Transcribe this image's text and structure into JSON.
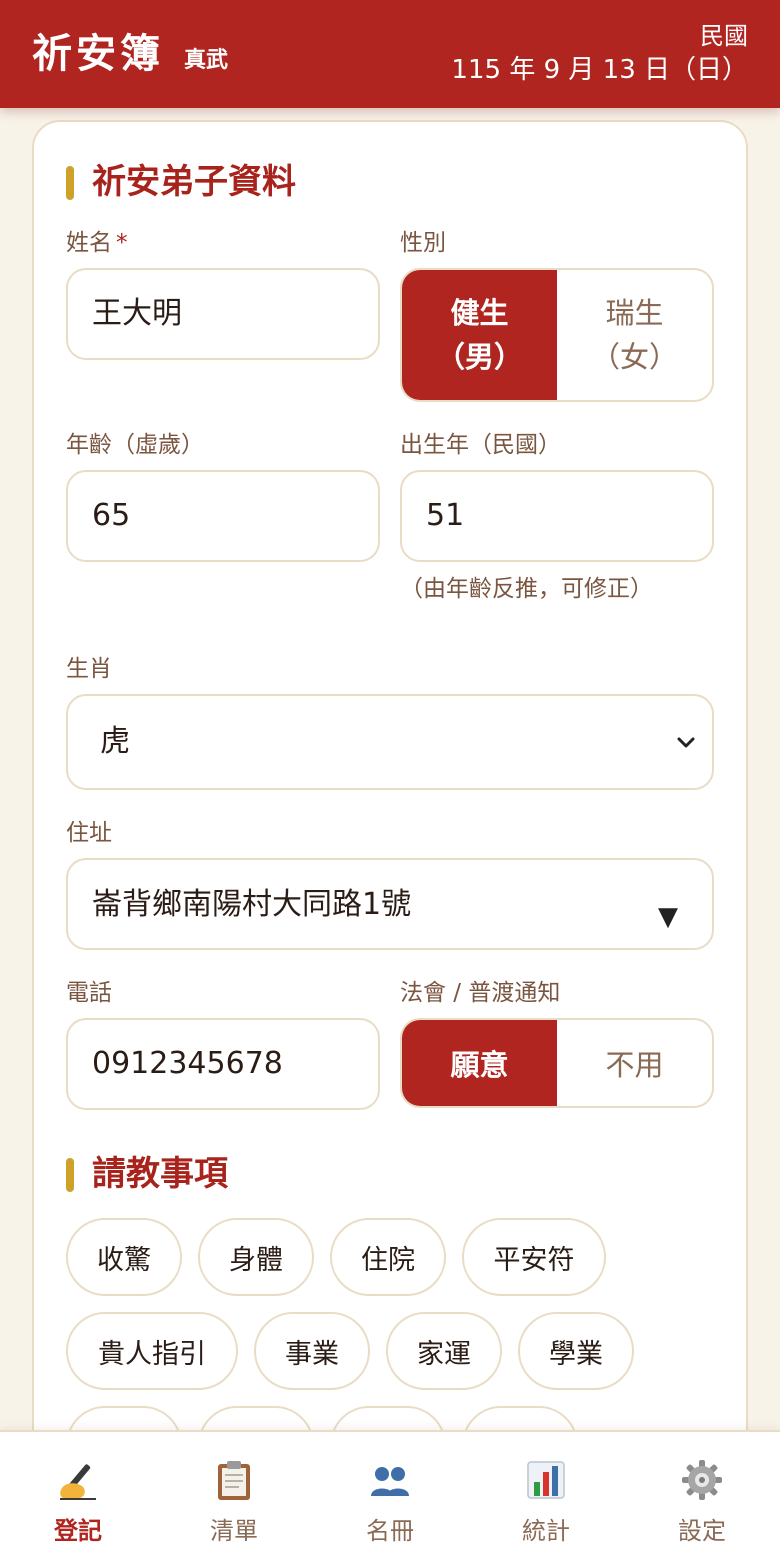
{
  "header": {
    "title": "祈安簿",
    "subtitle": "真武",
    "era": "民國",
    "date": "115 年 9 月 13 日（日）"
  },
  "form": {
    "section_title": "祈安弟子資料",
    "name": {
      "label": "姓名",
      "required_mark": "*",
      "value": "王大明"
    },
    "gender": {
      "label": "性別",
      "options": [
        "健生\n（男）",
        "瑞生\n（女）"
      ],
      "option_lines": [
        [
          "健生",
          "（男）"
        ],
        [
          "瑞生",
          "（女）"
        ]
      ],
      "selected": 0
    },
    "age": {
      "label": "年齡（虛歲）",
      "value": "65"
    },
    "birth_year": {
      "label": "出生年（民國）",
      "value": "51",
      "hint": "（由年齡反推，可修正）"
    },
    "zodiac": {
      "label": "生肖",
      "value": "虎"
    },
    "address": {
      "label": "住址",
      "value": "崙背鄉南陽村大同路1號"
    },
    "phone": {
      "label": "電話",
      "value": "0912345678"
    },
    "notify": {
      "label": "法會 / 普渡通知",
      "options": [
        "願意",
        "不用"
      ],
      "selected": 0
    }
  },
  "inquiry": {
    "section_title": "請教事項",
    "chips": [
      "收驚",
      "身體",
      "住院",
      "平安符",
      "貴人指引",
      "事業",
      "家運",
      "學業"
    ]
  },
  "nav": {
    "active": 0,
    "items": [
      {
        "label": "登記",
        "icon": "writing-hand-icon"
      },
      {
        "label": "清單",
        "icon": "clipboard-icon"
      },
      {
        "label": "名冊",
        "icon": "people-icon"
      },
      {
        "label": "統計",
        "icon": "bar-chart-icon"
      },
      {
        "label": "設定",
        "icon": "gear-icon"
      }
    ]
  },
  "colors": {
    "primary": "#b0251f",
    "accent": "#cfa02a",
    "background": "#f8f3e9",
    "border": "#e9dcc5"
  }
}
